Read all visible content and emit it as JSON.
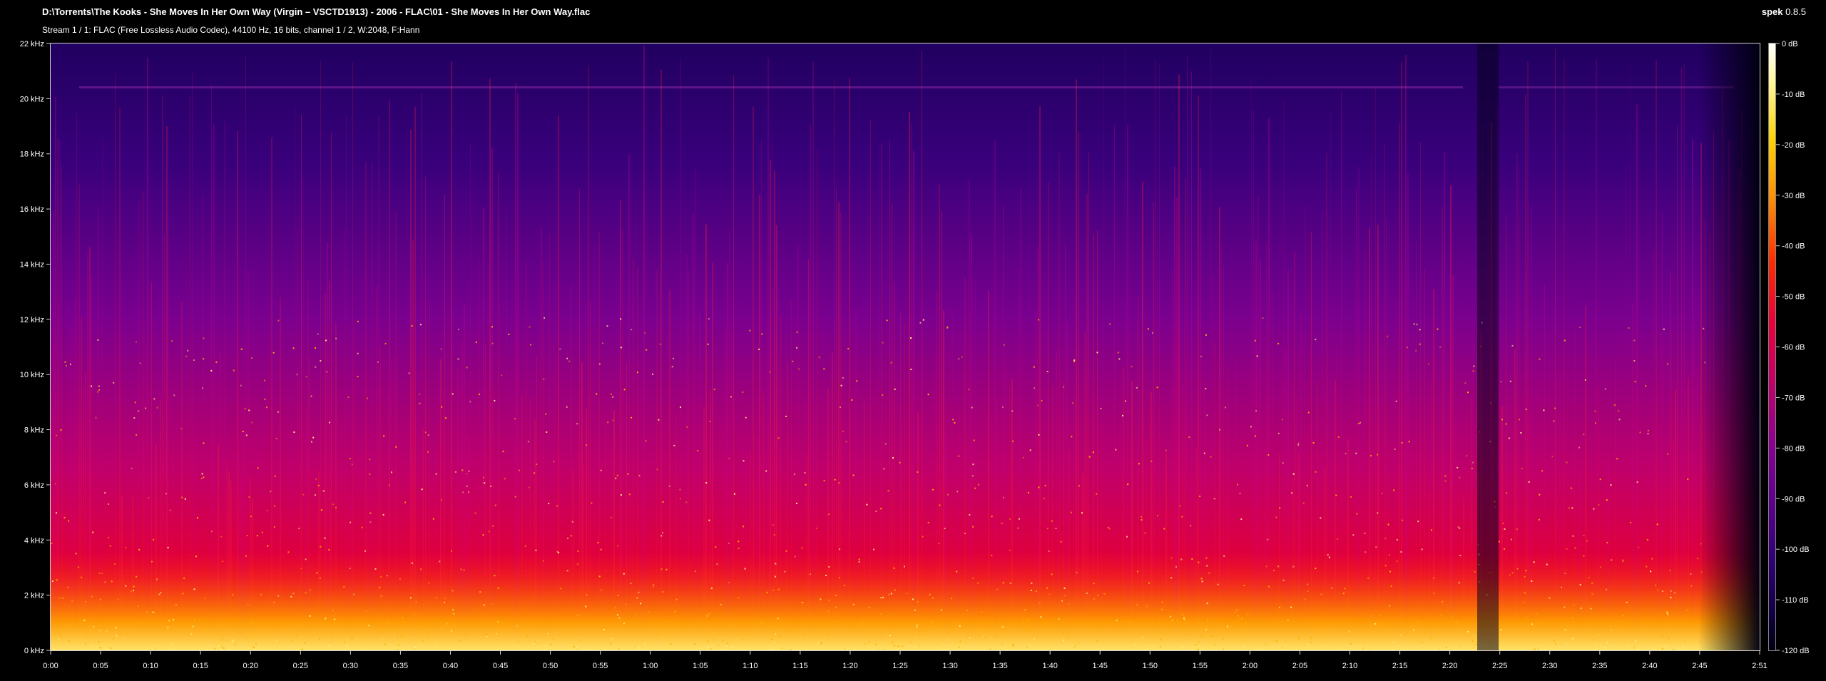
{
  "header": {
    "file_path": "D:\\Torrents\\The Kooks - She Moves In Her Own Way (Virgin – VSCTD1913) - 2006 - FLAC\\01 - She Moves In Her Own Way.flac",
    "stream_info": "Stream 1 / 1: FLAC (Free Lossless Audio Codec), 44100 Hz, 16 bits, channel 1 / 2, W:2048, F:Hann",
    "app_name": "spek",
    "app_version": "0.8.5"
  },
  "chart_data": {
    "type": "heatmap",
    "x_unit": "time",
    "y_unit": "kHz",
    "x_ticks": [
      "0:00",
      "0:05",
      "0:10",
      "0:15",
      "0:20",
      "0:25",
      "0:30",
      "0:35",
      "0:40",
      "0:45",
      "0:50",
      "0:55",
      "1:00",
      "1:05",
      "1:10",
      "1:15",
      "1:20",
      "1:25",
      "1:30",
      "1:35",
      "1:40",
      "1:45",
      "1:50",
      "1:55",
      "2:00",
      "2:05",
      "2:10",
      "2:15",
      "2:20",
      "2:25",
      "2:30",
      "2:35",
      "2:40",
      "2:45",
      "2:51"
    ],
    "x_tick_seconds": [
      0,
      5,
      10,
      15,
      20,
      25,
      30,
      35,
      40,
      45,
      50,
      55,
      60,
      65,
      70,
      75,
      80,
      85,
      90,
      95,
      100,
      105,
      110,
      115,
      120,
      125,
      130,
      135,
      140,
      145,
      150,
      155,
      160,
      165,
      171
    ],
    "xlim": [
      0,
      171
    ],
    "y_ticks": [
      "0 kHz",
      "2 kHz",
      "4 kHz",
      "6 kHz",
      "8 kHz",
      "10 kHz",
      "12 kHz",
      "14 kHz",
      "16 kHz",
      "18 kHz",
      "20 kHz",
      "22 kHz"
    ],
    "y_tick_values": [
      0,
      2,
      4,
      6,
      8,
      10,
      12,
      14,
      16,
      18,
      20,
      22
    ],
    "ylim": [
      0,
      22
    ],
    "colorbar_ticks": [
      "0 dB",
      "-10 dB",
      "-20 dB",
      "-30 dB",
      "-40 dB",
      "-50 dB",
      "-60 dB",
      "-70 dB",
      "-80 dB",
      "-90 dB",
      "-100 dB",
      "-110 dB",
      "-120 dB"
    ],
    "colorbar_values": [
      0,
      -10,
      -20,
      -30,
      -40,
      -50,
      -60,
      -70,
      -80,
      -90,
      -100,
      -110,
      -120
    ],
    "colorbar_range": [
      -120,
      0
    ],
    "colors": {
      "background": "#000000",
      "high": "#ffffff",
      "yellow": "#ffd200",
      "orange": "#ff8a00",
      "red": "#ff2a00",
      "magenta": "#c0006a",
      "purple": "#5a008c",
      "low": "#100040"
    }
  }
}
